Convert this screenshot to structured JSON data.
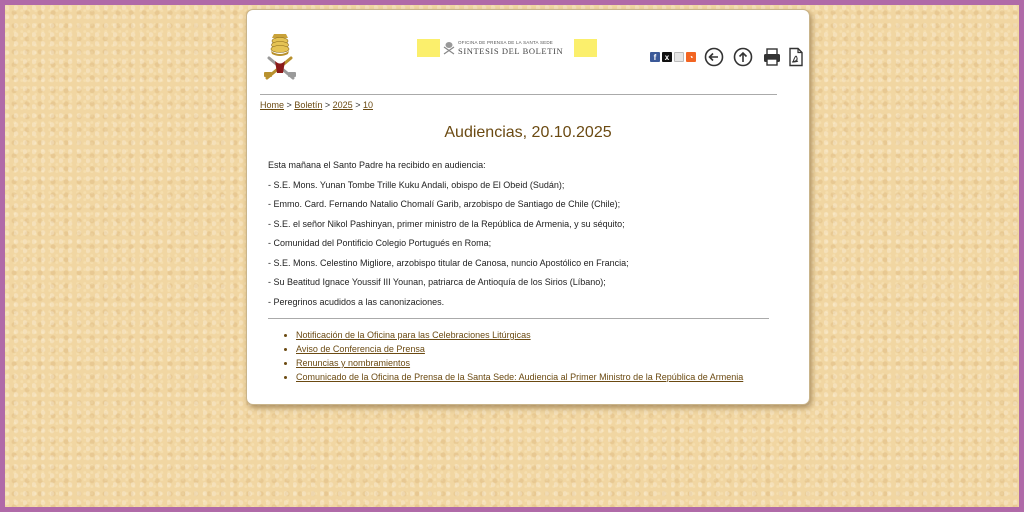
{
  "header": {
    "banner_line1": "OFICINA DE PRENSA DE LA SANTA SEDE",
    "banner_line2": "SINTESIS DEL BOLETIN"
  },
  "toolbar": {
    "icons": [
      "facebook-icon",
      "x-icon",
      "email-icon",
      "rss-icon",
      "back-arrow-icon",
      "up-arrow-icon",
      "print-icon",
      "pdf-icon"
    ]
  },
  "breadcrumb": {
    "items": [
      "Home",
      "Boletín",
      "2025",
      "10"
    ],
    "separator": ">"
  },
  "page": {
    "title": "Audiencias, 20.10.2025",
    "intro": "Esta mañana el Santo Padre ha recibido en audiencia:",
    "audiences": [
      "- S.E. Mons. Yunan Tombe Trille Kuku Andali, obispo de El Obeid (Sudán);",
      "- Emmo. Card. Fernando Natalio Chomalí Garib, arzobispo de Santiago de Chile (Chile);",
      "- S.E. el señor Nikol Pashinyan, primer ministro de la República de Armenia, y su séquito;",
      "- Comunidad del Pontificio Colegio Portugués en Roma;",
      "- S.E. Mons. Celestino Migliore, arzobispo titular de Canosa, nuncio Apostólico en Francia;",
      "- Su Beatitud Ignace Youssif III Younan, patriarca de Antioquía de los Sirios (Líbano);",
      "- Peregrinos acudidos a las canonizaciones."
    ]
  },
  "related_links": [
    "Notificación de la Oficina para las Celebraciones Litúrgicas",
    "Aviso de Conferencia de Prensa",
    "Renuncias y nombramientos",
    "Comunicado de la Oficina de Prensa de la Santa Sede: Audiencia al Primer Ministro de la República de Armenia"
  ],
  "colors": {
    "link": "#6b4a12",
    "banner_yellow": "#fbef6c",
    "page_bg": "#f1d6a2",
    "outer_border": "#b06aa8"
  }
}
